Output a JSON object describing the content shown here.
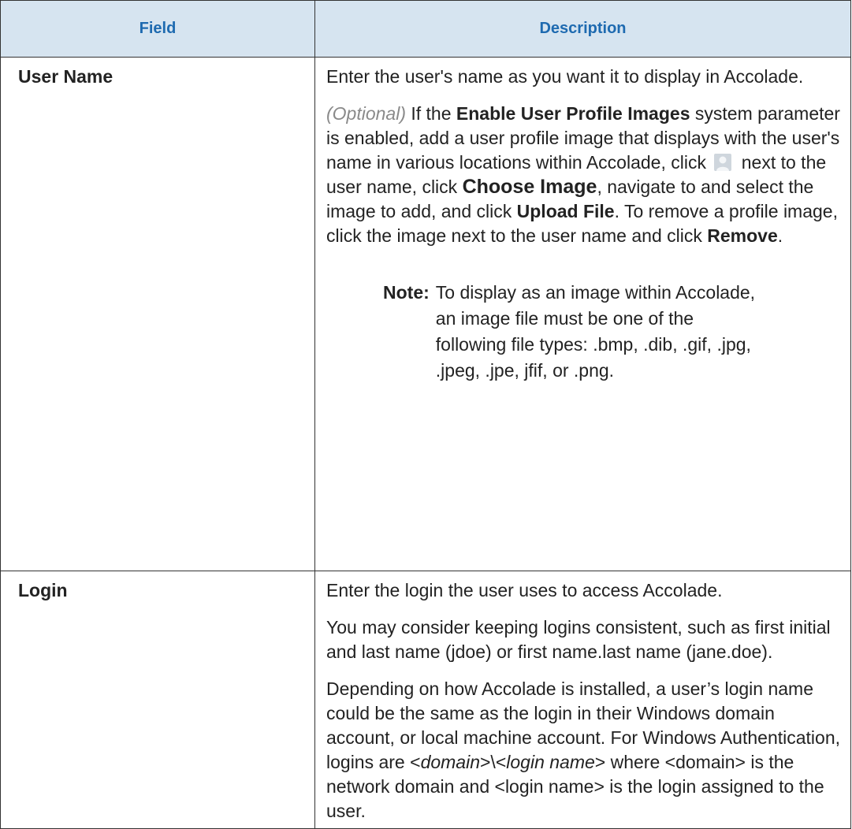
{
  "table": {
    "headers": [
      "Field",
      "Description"
    ],
    "user_name": {
      "field": "User Name",
      "p1": "Enter the user's name as you want it to display in Accolade.",
      "p2": {
        "optional": "(Optional)",
        "t1": " If the ",
        "b1": "Enable User Profile Images",
        "t2": " system parameter is enabled, add a user profile image that displays with the user's name in various locations within Accolade, click ",
        "icon": "user-profile-icon",
        "t3": " next to the user name, click ",
        "b2": "Choose Image",
        "t4": ", navigate to and select the image to add, and click ",
        "b3": "Upload File",
        "t5": ". To remove a profile image, click the image next to the user name and click ",
        "b4": "Remove",
        "t6": "."
      },
      "note_label": "Note:",
      "note_text": "To display as an image within Accolade, an image file must be one of the following file types: .bmp, .dib, .gif, .jpg, .jpeg, .jpe, jfif, or .png."
    },
    "login": {
      "field": "Login",
      "p1": "Enter the login the user uses to access Accolade.",
      "p2": "You may consider keeping logins consistent, such as first initial and last name (jdoe) or first name.last name (jane.doe).",
      "p3": {
        "t1": "Depending on how Accolade is installed, a user’s login name could be the same as the login in their Windows domain account, or local machine account. For Windows Authentication, logins are <",
        "i1": "domain",
        "t2": ">\\<",
        "i2": "login name",
        "t3": "> where <domain> is the network domain and <login name> is the login assigned to the user."
      }
    }
  }
}
